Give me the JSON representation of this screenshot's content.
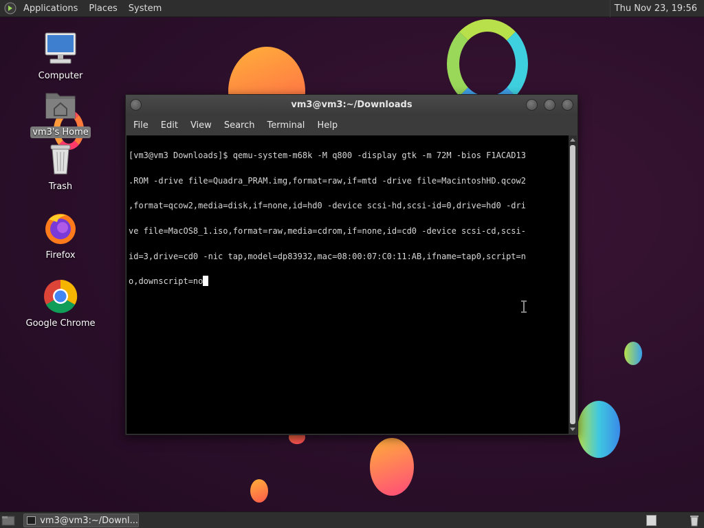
{
  "top_panel": {
    "menus": [
      "Applications",
      "Places",
      "System"
    ],
    "clock": "Thu Nov 23, 19:56",
    "apps_icon": "gnome-foot-icon"
  },
  "desktop": {
    "icons": [
      {
        "label": "Computer",
        "icon": "computer-icon",
        "selected": false
      },
      {
        "label": "vm3's Home",
        "icon": "home-folder-icon",
        "selected": true
      },
      {
        "label": "Trash",
        "icon": "trash-icon",
        "selected": false
      },
      {
        "label": "Firefox",
        "icon": "firefox-icon",
        "selected": false
      },
      {
        "label": "Google Chrome",
        "icon": "chrome-icon",
        "selected": false
      }
    ]
  },
  "terminal": {
    "title": "vm3@vm3:~/Downloads",
    "menu": [
      "File",
      "Edit",
      "View",
      "Search",
      "Terminal",
      "Help"
    ],
    "lines": [
      "[vm3@vm3 Downloads]$ qemu-system-m68k -M q800 -display gtk -m 72M -bios F1ACAD13",
      ".ROM -drive file=Quadra_PRAM.img,format=raw,if=mtd -drive file=MacintoshHD.qcow2",
      ",format=qcow2,media=disk,if=none,id=hd0 -device scsi-hd,scsi-id=0,drive=hd0 -dri",
      "ve file=MacOS8_1.iso,format=raw,media=cdrom,if=none,id=cd0 -device scsi-cd,scsi-",
      "id=3,drive=cd0 -nic tap,model=dp83932,mac=08:00:07:C0:11:AB,ifname=tap0,script=n",
      "o,downscript=no"
    ],
    "colors": {
      "background": "#000000",
      "foreground": "#d8d8d8",
      "cursor": "#ffffff"
    }
  },
  "bottom_panel": {
    "task_label": "vm3@vm3:~/Downl..."
  }
}
